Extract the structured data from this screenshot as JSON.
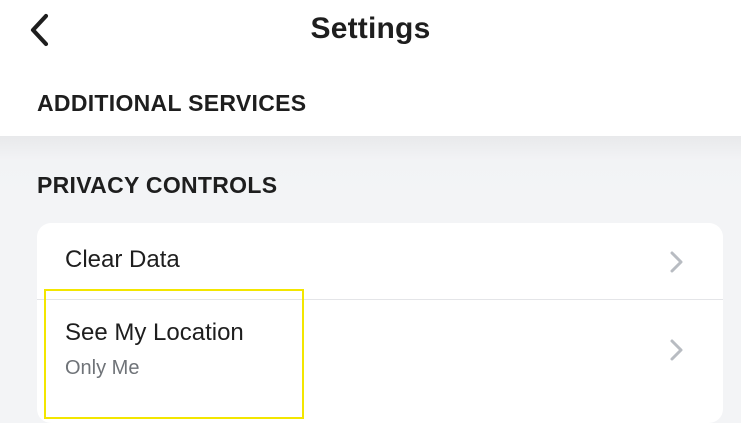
{
  "header": {
    "title": "Settings",
    "back_icon": "chevron-left-icon"
  },
  "sections": {
    "additional_services": {
      "title": "ADDITIONAL SERVICES"
    },
    "privacy_controls": {
      "title": "PRIVACY CONTROLS",
      "items": [
        {
          "label": "Clear Data",
          "icon": "chevron-right-icon"
        },
        {
          "label": "See My Location",
          "value": "Only Me",
          "icon": "chevron-right-icon"
        }
      ]
    }
  },
  "colors": {
    "background": "#f3f4f6",
    "card": "#ffffff",
    "primary_text": "#1e1e1e",
    "secondary_text": "#6f7378",
    "chevron": "#b8bcc2",
    "highlight": "#f3e600"
  }
}
